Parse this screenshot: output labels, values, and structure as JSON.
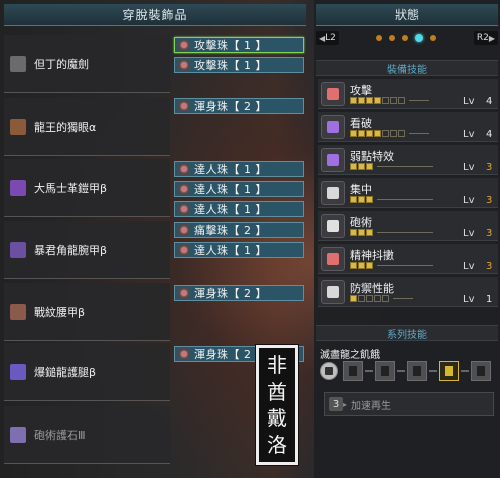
{
  "left": {
    "title": "穿脫裝飾品",
    "equipment": [
      {
        "name": "但丁的魔劍",
        "icon": "sword-icon",
        "color": "#6b6b6b"
      },
      {
        "name": "龍王的獨眼α",
        "icon": "helm-icon",
        "color": "#8a5a3a"
      },
      {
        "name": "大馬士革鎧甲β",
        "icon": "chest-armor-icon",
        "color": "#7a4ab0"
      },
      {
        "name": "暴君角龍腕甲β",
        "icon": "arm-armor-icon",
        "color": "#6b4fa0"
      },
      {
        "name": "戰紋腰甲β",
        "icon": "waist-armor-icon",
        "color": "#8a5a4a"
      },
      {
        "name": "爆鎚龍護腿β",
        "icon": "leg-armor-icon",
        "color": "#6a5ac0"
      },
      {
        "name": "砲術護石Ⅲ",
        "icon": "charm-icon",
        "color": "#7f6fb0"
      }
    ],
    "decorations": [
      {
        "label": "攻擊珠【 1 】",
        "selected": true
      },
      {
        "label": "攻擊珠【 1 】",
        "selected": false
      },
      {
        "label": "渾身珠【 2 】",
        "selected": false
      },
      {
        "label": "達人珠【 1 】",
        "selected": false
      },
      {
        "label": "達人珠【 1 】",
        "selected": false
      },
      {
        "label": "達人珠【 1 】",
        "selected": false
      },
      {
        "label": "痛擊珠【 2 】",
        "selected": false
      },
      {
        "label": "達人珠【 1 】",
        "selected": false
      },
      {
        "label": "渾身珠【 2 】",
        "selected": false
      },
      {
        "label": "渾身珠【 2 】",
        "selected": false
      }
    ],
    "seal": [
      "非",
      "酋",
      "戴",
      "洛"
    ]
  },
  "right": {
    "title": "狀態",
    "pager": {
      "left": "L2",
      "right": "R2"
    },
    "equip_skills_title": "裝備技能",
    "lv_label": "Lv",
    "skills": [
      {
        "name": "攻擊",
        "level": 4,
        "max": 7,
        "maxed": false,
        "icon": "attack-skill-icon",
        "color": "#e07070"
      },
      {
        "name": "看破",
        "level": 4,
        "max": 7,
        "maxed": false,
        "icon": "critical-eye-skill-icon",
        "color": "#a070e0"
      },
      {
        "name": "弱點特效",
        "level": 3,
        "max": 3,
        "maxed": true,
        "icon": "weakness-exploit-skill-icon",
        "color": "#a070e0"
      },
      {
        "name": "集中",
        "level": 3,
        "max": 3,
        "maxed": true,
        "icon": "focus-skill-icon",
        "color": "#d8d8d8"
      },
      {
        "name": "砲術",
        "level": 3,
        "max": 3,
        "maxed": true,
        "icon": "artillery-skill-icon",
        "color": "#e0e0e0"
      },
      {
        "name": "精神抖擻",
        "level": 3,
        "max": 3,
        "maxed": true,
        "icon": "maximum-might-skill-icon",
        "color": "#e07070"
      },
      {
        "name": "防禦性能",
        "level": 1,
        "max": 5,
        "maxed": false,
        "icon": "guard-skill-icon",
        "color": "#d8d8d8"
      }
    ],
    "set_skills_title": "系列技能",
    "set_name": "滅盡龍之飢餓",
    "set_pieces_equipped": 1,
    "set_bonus": {
      "count": "3",
      "text": "加速再生"
    }
  }
}
